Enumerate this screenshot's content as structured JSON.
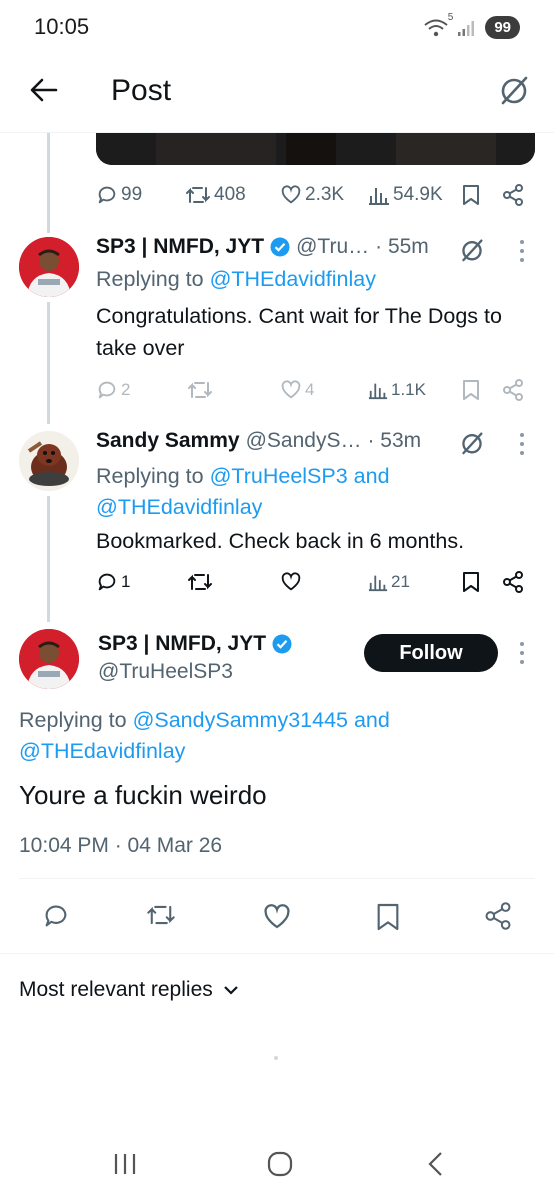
{
  "status_bar": {
    "time": "10:05",
    "battery": "99",
    "signal_sup": "5"
  },
  "header": {
    "title": "Post"
  },
  "prev_tweet_actions": {
    "replies": "99",
    "reposts": "408",
    "likes": "2.3K",
    "views": "54.9K"
  },
  "replies": [
    {
      "name": "SP3 | NMFD, JYT",
      "handle": "@Tru…",
      "time": "· 55m",
      "replying_prefix": "Replying to",
      "replying_line1": "@THEdavidfinlay",
      "replying_line2": "",
      "text": "Congratulations. Cant wait for The Dogs to take over",
      "replies_count": "2",
      "reposts_count": "",
      "likes_count": "4",
      "views_count": "1.1K"
    },
    {
      "name": "Sandy Sammy",
      "handle": "@SandyS…",
      "time": "· 53m",
      "replying_prefix": "Replying to",
      "replying_line1": "@TruHeelSP3 and",
      "replying_line2": "@THEdavidfinlay",
      "text": "Bookmarked. Check back in 6 months.",
      "replies_count": "1",
      "reposts_count": "",
      "likes_count": "",
      "views_count": "21"
    }
  ],
  "main_tweet": {
    "name": "SP3 | NMFD, JYT",
    "handle": "@TruHeelSP3",
    "follow_label": "Follow",
    "replying_prefix": "Replying to",
    "replying_line1": "@SandySammy31445 and",
    "replying_line2": "@THEdavidfinlay",
    "text": "Youre a fuckin weirdo",
    "timestamp": "10:04 PM · 04 Mar 26"
  },
  "sort": {
    "label": "Most relevant replies"
  },
  "colors": {
    "accent": "#1d9bf0",
    "text": "#0f1419",
    "muted": "#536471"
  }
}
